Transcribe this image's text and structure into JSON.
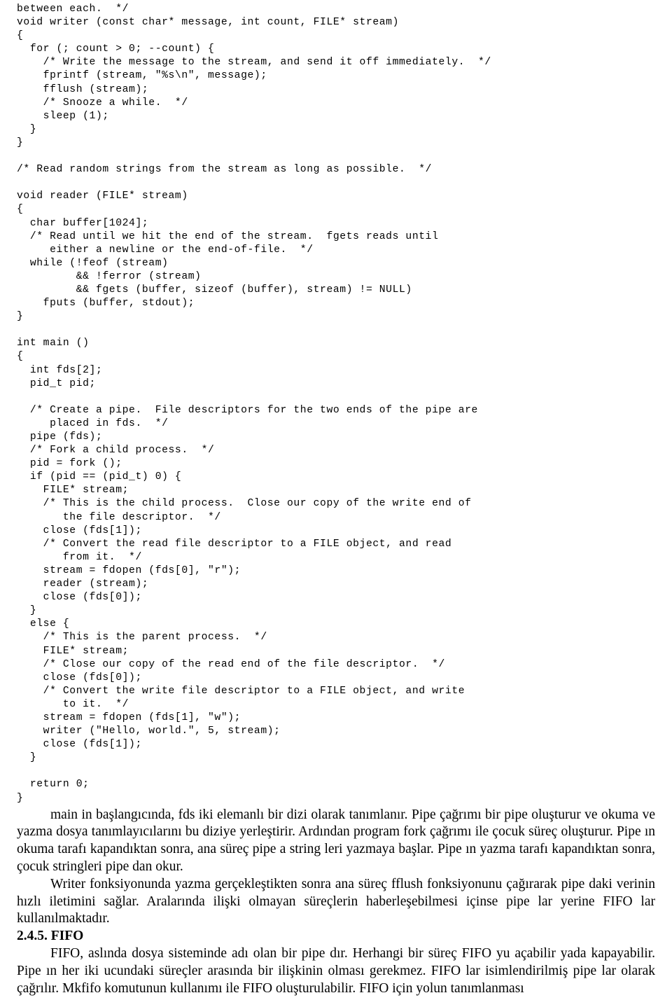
{
  "document": {
    "code_listing": "between each.  */\nvoid writer (const char* message, int count, FILE* stream)\n{\n  for (; count > 0; --count) {\n    /* Write the message to the stream, and send it off immediately.  */\n    fprintf (stream, \"%s\\n\", message);\n    fflush (stream);\n    /* Snooze a while.  */\n    sleep (1);\n  }\n}\n\n/* Read random strings from the stream as long as possible.  */\n\nvoid reader (FILE* stream)\n{\n  char buffer[1024];\n  /* Read until we hit the end of the stream.  fgets reads until\n     either a newline or the end-of-file.  */\n  while (!feof (stream)\n         && !ferror (stream)\n         && fgets (buffer, sizeof (buffer), stream) != NULL)\n    fputs (buffer, stdout);\n}\n\nint main ()\n{\n  int fds[2];\n  pid_t pid;\n\n  /* Create a pipe.  File descriptors for the two ends of the pipe are\n     placed in fds.  */\n  pipe (fds);\n  /* Fork a child process.  */\n  pid = fork ();\n  if (pid == (pid_t) 0) {\n    FILE* stream;\n    /* This is the child process.  Close our copy of the write end of\n       the file descriptor.  */\n    close (fds[1]);\n    /* Convert the read file descriptor to a FILE object, and read\n       from it.  */\n    stream = fdopen (fds[0], \"r\");\n    reader (stream);\n    close (fds[0]);\n  }\n  else {\n    /* This is the parent process.  */\n    FILE* stream;\n    /* Close our copy of the read end of the file descriptor.  */\n    close (fds[0]);\n    /* Convert the write file descriptor to a FILE object, and write\n       to it.  */\n    stream = fdopen (fds[1], \"w\");\n    writer (\"Hello, world.\", 5, stream);\n    close (fds[1]);\n  }\n\n  return 0;\n}",
    "paragraphs": [
      "main in başlangıcında, fds iki elemanlı bir dizi olarak tanımlanır. Pipe çağrımı bir pipe oluşturur ve okuma ve yazma dosya tanımlayıcılarını bu diziye yerleştirir. Ardından program fork çağrımı ile çocuk süreç oluşturur. Pipe ın okuma tarafı kapandıktan sonra, ana süreç pipe a string leri yazmaya başlar. Pipe ın yazma tarafı kapandıktan sonra, çocuk stringleri pipe dan okur.",
      "Writer fonksiyonunda yazma gerçekleştikten sonra ana süreç fflush fonksiyonunu çağırarak pipe daki verinin hızlı iletimini sağlar. Aralarında ilişki olmayan süreçlerin haberleşebilmesi içinse pipe lar yerine FIFO lar kullanılmaktadır."
    ],
    "section_heading": "2.4.5. FIFO",
    "closing_paragraph": "FIFO, aslında dosya sisteminde adı olan bir pipe dır. Herhangi bir süreç FIFO yu açabilir yada kapayabilir. Pipe ın her iki ucundaki süreçler arasında bir ilişkinin olması gerekmez. FIFO lar isimlendirilmiş pipe lar olarak çağrılır. Mkfifo komutunun kullanımı ile FIFO oluşturulabilir. FIFO için yolun tanımlanması"
  }
}
